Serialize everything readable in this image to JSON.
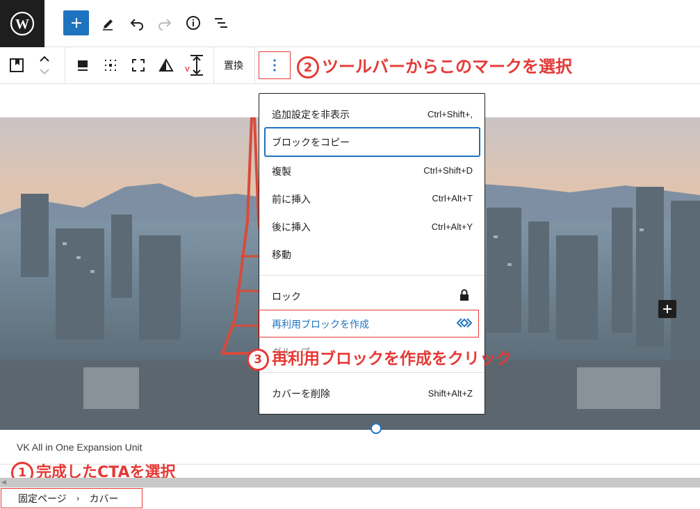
{
  "header": {
    "icons": [
      "wordpress-logo-icon",
      "add-block-icon",
      "pencil-icon",
      "undo-icon",
      "redo-icon",
      "info-icon",
      "list-view-icon"
    ]
  },
  "block_toolbar": {
    "replace_label": "置換"
  },
  "annotations": {
    "step1": {
      "num": "1",
      "text": "完成したCTAを選択"
    },
    "step2": {
      "num": "2",
      "text": "ツールバーからこのマークを選択"
    },
    "step3": {
      "num": "3",
      "text": "再利用ブロックを作成をクリック"
    }
  },
  "menu": {
    "items": [
      {
        "label": "追加設定を非表示",
        "shortcut": "Ctrl+Shift+,"
      },
      {
        "label": "ブロックをコピー",
        "shortcut": ""
      },
      {
        "label": "複製",
        "shortcut": "Ctrl+Shift+D"
      },
      {
        "label": "前に挿入",
        "shortcut": "Ctrl+Alt+T"
      },
      {
        "label": "後に挿入",
        "shortcut": "Ctrl+Alt+Y"
      },
      {
        "label": "移動",
        "shortcut": ""
      }
    ],
    "lock_label": "ロック",
    "reusable_label": "再利用ブロックを作成",
    "group_label": "グループ",
    "remove_label": "カバーを削除",
    "remove_shortcut": "Shift+Alt+Z"
  },
  "content": {
    "vk_label": "VK All in One Expansion Unit"
  },
  "breadcrumb": {
    "items": [
      "固定ページ",
      "カバー"
    ]
  },
  "colors": {
    "accent": "#1e73be",
    "annotation": "#e53935",
    "dark": "#1e1e1e"
  }
}
